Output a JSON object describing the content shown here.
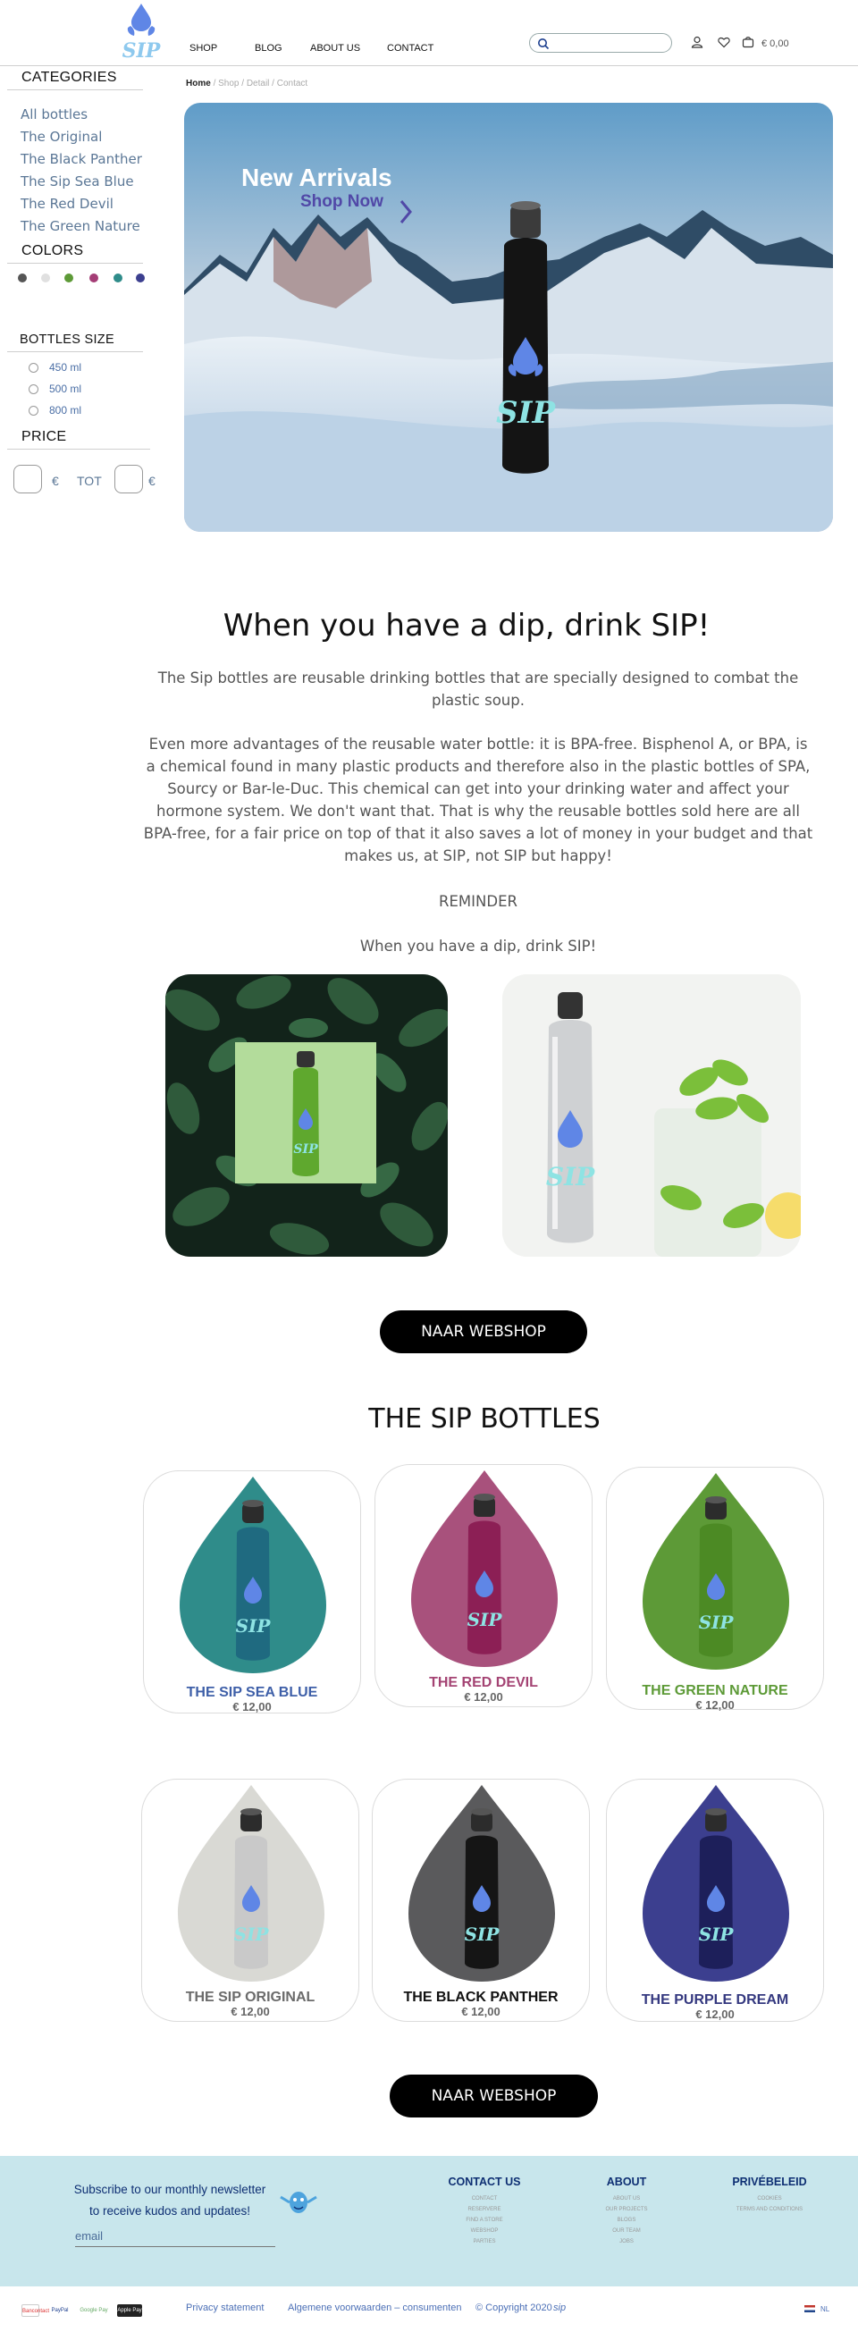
{
  "header": {
    "nav": [
      "SHOP",
      "BLOG",
      "ABOUT US",
      "CONTACT"
    ],
    "cart_amount": "€ 0,00"
  },
  "sidebar": {
    "categories_title": "CATEGORIES",
    "categories": [
      "All bottles",
      "The Original",
      "The Black Panther",
      "The Sip Sea Blue",
      "The Red Devil",
      "The Green Nature"
    ],
    "colors_title": "COLORS",
    "colors": [
      "#555555",
      "#e0e0e0",
      "#5d9a37",
      "#a43d76",
      "#2f8c8a",
      "#3c3f8f"
    ],
    "size_title": "BOTTLES SIZE",
    "sizes": [
      "450 ml",
      "500 ml",
      "800 ml"
    ],
    "price_title": "PRICE",
    "price_currency": "€",
    "price_to": "TOT"
  },
  "breadcrumb": {
    "home": "Home",
    "rest": "/ Shop / Detail / Contact"
  },
  "hero": {
    "title": "New Arrivals",
    "cta": "Shop Now"
  },
  "intro": {
    "headline": "When you have a dip, drink SIP!",
    "p1": "The Sip bottles are reusable drinking bottles that are specially designed to combat the plastic soup.",
    "p2": "Even more advantages of the reusable water bottle: it is BPA-free. Bisphenol A, or BPA, is a chemical found in many plastic products and therefore also in the plastic bottles of SPA, Sourcy or Bar-le-Duc. This chemical can get into your drinking water and affect your hormone system. We don't want that. That is why the reusable bottles sold here are all BPA-free, for a fair price on top of that it also saves a lot of money in your budget and that makes us, at SIP, not SIP but happy!",
    "reminder": "REMINDER",
    "tagline": "When you have a dip, drink SIP!"
  },
  "cta_button": "NAAR WEBSHOP",
  "products_title": "THE SIP BOTTLES",
  "products": [
    {
      "name": "THE SIP SEA BLUE",
      "price": "€ 12,00",
      "drop": "#2f8c8a",
      "bottle": "#1f6a80",
      "name_color": "#3e5fa8"
    },
    {
      "name": "THE RED DEVIL",
      "price": "€ 12,00",
      "drop": "#a8517c",
      "bottle": "#8c1f55",
      "name_color": "#a44373"
    },
    {
      "name": "THE GREEN NATURE",
      "price": "€ 12,00",
      "drop": "#5d9a37",
      "bottle": "#4c8a24",
      "name_color": "#5d9a37"
    },
    {
      "name": "THE SIP ORIGINAL",
      "price": "€ 12,00",
      "drop": "#d9d9d4",
      "bottle": "#c9c9c9",
      "name_color": "#6b6b6b"
    },
    {
      "name": "THE BLACK PANTHER",
      "price": "€ 12,00",
      "drop": "#5a5a5c",
      "bottle": "#151515",
      "name_color": "#111111"
    },
    {
      "name": "THE PURPLE DREAM",
      "price": "€ 12,00",
      "drop": "#3c3f8f",
      "bottle": "#1d1f5a",
      "name_color": "#34387f"
    }
  ],
  "footer": {
    "newsletter": "Subscribe to our monthly newsletter to receive kudos and updates!",
    "email_placeholder": "email",
    "contact_title": "CONTACT US",
    "contact_links": [
      "CONTACT",
      "RESERVERE",
      "FIND A STORE",
      "WEBSHOP",
      "PARTIES"
    ],
    "about_title": "ABOUT",
    "about_links": [
      "ABOUT US",
      "OUR PROJECTS",
      "BLOGS",
      "OUR TEAM",
      "JOBS"
    ],
    "privacy_title": "PRIVÉBELEID",
    "privacy_links": [
      "COOKIES",
      "TERMS AND CONDITIONS"
    ],
    "bottom": {
      "payments": [
        "Bancontact",
        "PayPal",
        "Google Pay",
        "Apple Pay"
      ],
      "privacy": "Privacy statement",
      "terms": "Algemene voorwaarden – consumenten",
      "copyright": "© Copyright 2020",
      "brand": "sip",
      "lang": "NL"
    }
  }
}
